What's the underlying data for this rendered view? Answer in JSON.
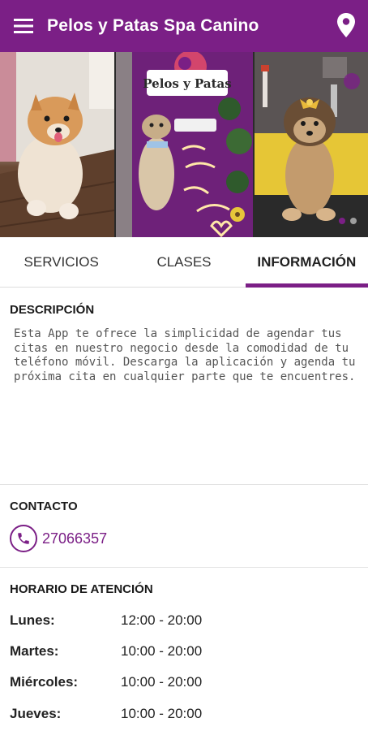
{
  "app_bar": {
    "title": "Pelos y Patas Spa Canino",
    "color": "#7b1f86",
    "menu_icon": "hamburger-menu-icon",
    "location_icon": "location-pin-icon"
  },
  "gallery": {
    "slides": [
      {
        "description": "pomeranian-photo"
      },
      {
        "description": "spa-logo-wall-photo",
        "sign_text": "Pelos y Patas"
      },
      {
        "description": "yorkie-with-bow-photo"
      }
    ],
    "active_index": 0,
    "slide_count": 2
  },
  "tabs": [
    {
      "label": "SERVICIOS",
      "active": false
    },
    {
      "label": "CLASES",
      "active": false
    },
    {
      "label": "INFORMACIÓN",
      "active": true
    }
  ],
  "description": {
    "title": "DESCRIPCIÓN",
    "text": "Esta App te ofrece la simplicidad de agendar tus citas en nuestro negocio desde la comodidad de tu teléfono móvil. Descarga la aplicación y agenda tu próxima cita en cualquier parte que te encuentres."
  },
  "contact": {
    "title": "CONTACTO",
    "phone": "27066357",
    "phone_icon": "phone-icon"
  },
  "hours": {
    "title": "HORARIO DE ATENCIÓN",
    "rows": [
      {
        "day": "Lunes:",
        "hours": "12:00 - 20:00"
      },
      {
        "day": "Martes:",
        "hours": "10:00 - 20:00"
      },
      {
        "day": "Miércoles:",
        "hours": "10:00 - 20:00"
      },
      {
        "day": "Jueves:",
        "hours": "10:00 - 20:00"
      }
    ]
  }
}
